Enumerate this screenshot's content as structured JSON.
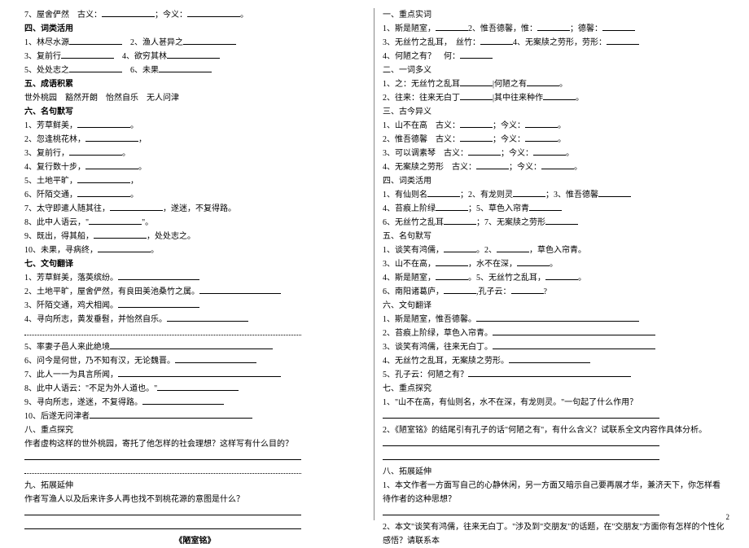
{
  "left": {
    "l1_label": "7、屋舍俨然",
    "l1_gu": "古义：",
    "l1_jin": "；今义：",
    "sec4": "四、词类活用",
    "s4_1": "1、林尽水源",
    "s4_2": "2、渔人甚异之",
    "s4_3": "3、复前行",
    "s4_4": "4、欲穷其林",
    "s4_5": "5、处处志之",
    "s4_6": "6、未果",
    "sec5": "五、成语积累",
    "s5_text": "世外桃园　豁然开朗　怡然自乐　无人问津",
    "sec6": "六、名句默写",
    "s6_1": "1、芳草鲜美，",
    "s6_2": "2、忽逢桃花林，",
    "s6_3": "3、复前行，",
    "s6_4": "4、复行数十步，",
    "s6_5": "5、土地平旷，",
    "s6_6": "6、阡陌交通，",
    "s6_7a": "7、太守即遣人随其往，",
    "s6_7b": "，遂迷，不复得路。",
    "s6_8a": "8、此中人语云，\"",
    "s6_8b": "\"。",
    "s6_9a": "9、既出，得其船，",
    "s6_9b": "，处处志之。",
    "s6_10": "10、未果，寻病终，",
    "sec7": "七、文句翻译",
    "s7_1": "1、芳草鲜美，落英缤纷。",
    "s7_2": "2、土地平旷，屋舍俨然，有良田美池桑竹之属。",
    "s7_3": "3、阡陌交通，鸡犬相闻。",
    "s7_4": "4、寻向所志，黄发垂髫，并怡然自乐。",
    "s7_5": "5、率妻子邑人来此绝境",
    "s7_6": "6、问今是何世，乃不知有汉，无论魏晋。",
    "s7_7": "7、此人一一为具言所闻，",
    "s7_8": "8、此中人语云：\"不足为外人道也。\"",
    "s7_9": "9、寻向所志，遂迷，不复得路。",
    "s7_10": "10、后遂无问津者",
    "sec8": "八、重点探究",
    "s8_q": "作者虚构这样的世外桃园，寄托了他怎样的社会理想？这样写有什么目的？",
    "sec9": "九、拓展延伸",
    "s9_q": "作者写渔人以及后来许多人再也找不到桃花源的意图是什么？",
    "title": "《陋室铭》"
  },
  "right": {
    "sec1": "一、重点实词",
    "r1_1a": "1、斯是陋室，",
    "r1_1b": "2、惟吾德馨，惟：",
    "r1_1c": "；德馨：",
    "r1_3a": "3、无丝竹之乱耳，　丝竹：",
    "r1_3b": "4、无案牍之劳形，劳形：",
    "r1_4a": "4、何陋之有？　何：",
    "sec2": "二、一词多义",
    "r2_1a": "1、之：无丝竹之乱耳",
    "r2_1b": "|何陋之有",
    "r2_2a": "2、往来：往来无白丁",
    "r2_2b": "|其中往来种作",
    "sec3": "三、古今异义",
    "r3_1": "1、山不在高",
    "r3_2": "2、惟吾德馨",
    "r3_3": "3、可以调素琴",
    "r3_4": "4、无案牍之劳形",
    "gu": "古义：",
    "jin": "；今义：",
    "sec4": "四、词类活用",
    "r4_1a": "1、有仙则名",
    "r4_1b": "；2、有龙则灵",
    "r4_1c": "；3、惟吾德馨",
    "r4_2a": "4、苔痕上阶绿",
    "r4_2b": "；5、草色入帘青",
    "r4_3a": "6、无丝竹之乱耳",
    "r4_3b": "；7、无案牍之劳形",
    "sec5": "五、名句默写",
    "r5_1a": "1、谈笑有鸿儒，",
    "r5_1b": "。2、",
    "r5_1c": "，草色入帘青。",
    "r5_2a": "3、山不在高，",
    "r5_2b": "，水不在深，",
    "r5_3a": "4、斯是陋室，",
    "r5_3b": "。5、无丝竹之乱耳，",
    "r5_4a": "6、南阳诸葛庐，",
    "r5_4b": ",孔子云：",
    "r5_4c": "?",
    "sec6": "六、文句翻译",
    "r6_1": "1、斯是陋室，惟吾德馨。",
    "r6_2": "2、苔痕上阶绿，草色入帘青。",
    "r6_3": "3、谈笑有鸿儒，往来无白丁。",
    "r6_4": "4、无丝竹之乱耳，无案牍之劳形。",
    "r6_5": "5、孔子云：何陋之有？",
    "sec7": "七、重点探究",
    "r7_1": "1、\"山不在高，有仙则名，水不在深，有龙则灵。\"一句起了什么作用？",
    "r7_2": "2、《陋室铭》的结尾引有孔子的话\"何陋之有\"，有什么含义？试联系全文内容作具体分析。",
    "sec8": "八、拓展延伸",
    "r8_1": "1、本文作者一方面写自己的心静休闲，另一方面又暗示自己要再展才华，兼济天下，你怎样看待作者的这种思想？",
    "r8_2": "2、本文\"谈笑有鸿儒，往来无白丁。\"涉及到\"交朋友\"的话题，在\"交朋友\"方面你有怎样的个性化感悟？请联系本"
  },
  "pagenum": "2"
}
